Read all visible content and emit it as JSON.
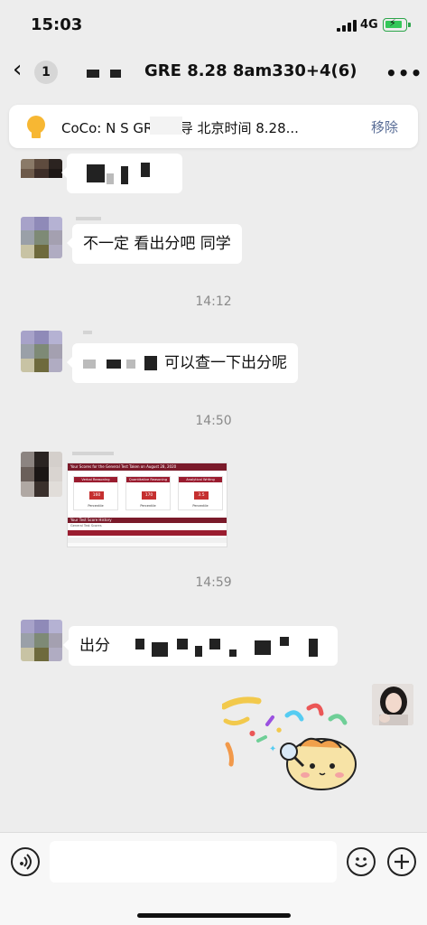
{
  "status": {
    "time": "15:03",
    "network": "4G"
  },
  "nav": {
    "back_icon": "chevron-left-icon",
    "unread_count": "1",
    "title": "GRE 8.28 8am330+4(6)",
    "more_icon": "ellipsis-icon"
  },
  "pinned": {
    "icon": "lightbulb-icon",
    "text": "CoCo: N          S GRE 辅导 北京时间 8.28...",
    "action": "移除"
  },
  "messages": [
    {
      "type": "text",
      "text": "不一定 看出分吧 同学"
    },
    {
      "type": "text",
      "text": "可以查一下出分呢"
    },
    {
      "type": "image",
      "desc": "GRE score report screenshot"
    },
    {
      "type": "text",
      "text": "出分"
    }
  ],
  "timestamps": [
    "14:12",
    "14:50",
    "14:59"
  ],
  "score_shot": {
    "header": "Your Scores for the General Test Taken on August 28, 2020",
    "sections": [
      {
        "name": "Verbal Reasoning",
        "score": "160",
        "label": "Percentile"
      },
      {
        "name": "Quantitative Reasoning",
        "score": "170",
        "label": "Percentile"
      },
      {
        "name": "Analytical Writing",
        "score": "3.5",
        "label": "Percentile"
      }
    ],
    "history_header": "Your Test Score History",
    "history_sub": "General Test Scores"
  },
  "input_bar": {
    "voice_icon": "voice-icon",
    "emoji_icon": "emoji-icon",
    "plus_icon": "plus-icon"
  },
  "colors": {
    "background": "#ededed",
    "bubble": "#ffffff",
    "link": "#576b95",
    "time": "#8a8a8a"
  }
}
